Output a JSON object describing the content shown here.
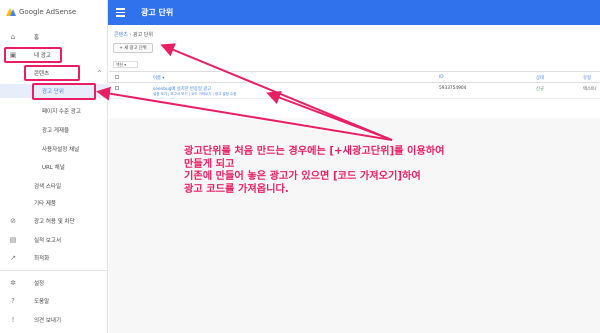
{
  "brand": {
    "name": "Google AdSense"
  },
  "topbar": {
    "title": "광고 단위",
    "menu_icon": "hamburger-icon"
  },
  "sidebar": {
    "items": [
      {
        "icon": "home-icon",
        "glyph": "⌂",
        "label": "홈"
      },
      {
        "icon": "my-ads-icon",
        "glyph": "▣",
        "label": "내 광고"
      },
      {
        "label": "콘텐츠",
        "chevron": "^"
      },
      {
        "label": "광고 단위"
      },
      {
        "label": "페이지 수준 광고"
      },
      {
        "label": "광고 게재율"
      },
      {
        "label": "사용자설정 채널"
      },
      {
        "label": "URL 채널"
      },
      {
        "label": "검색 스타일"
      },
      {
        "label": "기타 제품"
      },
      {
        "icon": "block-icon",
        "glyph": "⊘",
        "label": "광고 허용 및 차단"
      },
      {
        "icon": "reports-icon",
        "glyph": "▤",
        "label": "실적 보고서"
      },
      {
        "icon": "optimize-icon",
        "glyph": "↗",
        "label": "최적화"
      },
      {
        "icon": "settings-icon",
        "glyph": "✲",
        "label": "설정"
      },
      {
        "icon": "help-icon",
        "glyph": "?",
        "label": "도움말"
      },
      {
        "icon": "feedback-icon",
        "glyph": "!",
        "label": "의견 보내기"
      }
    ]
  },
  "breadcrumb": {
    "parent": "콘텐츠",
    "separator": "›",
    "current": "광고 단위"
  },
  "new_button": {
    "label": "+ 새 광고 단위"
  },
  "filter": {
    "label": "액션 ▾"
  },
  "table": {
    "headers": {
      "name": "이름 ▾",
      "id": "ID",
      "status": "상태",
      "type": "유형"
    },
    "rows": [
      {
        "name": "seenbug에 설치한 반응형 광고",
        "links": "설정 보기 | 보고서 보기 | 코드 가져오기 | 광고 설정 수정",
        "id": "5933754904",
        "status": "신규",
        "type": "텍스트/"
      }
    ]
  },
  "annotation": {
    "lines": [
      "광고단위를 처음 만드는 경우에는 [+새광고단위]를 이용하여",
      "만들게 되고",
      "기존에 만들어 놓은 광고가 있으면 [코드 가져오기]하여",
      "광고 코드를 가져옵니다."
    ],
    "color": "#e91e63"
  },
  "colors": {
    "topbar": "#2f72ec",
    "accent": "#4184f3",
    "highlight": "#e91e63",
    "status_new": "#27a84a"
  }
}
